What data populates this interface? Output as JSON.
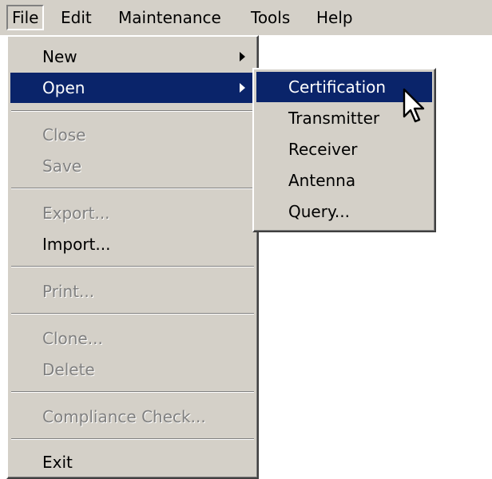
{
  "menubar": {
    "items": [
      {
        "label": "File"
      },
      {
        "label": "Edit"
      },
      {
        "label": "Maintenance"
      },
      {
        "label": "Tools"
      },
      {
        "label": "Help"
      }
    ]
  },
  "file_menu": {
    "items": [
      {
        "label": "New",
        "enabled": true,
        "has_submenu": true
      },
      {
        "label": "Open",
        "enabled": true,
        "has_submenu": true,
        "highlighted": true
      },
      {
        "label": "Close",
        "enabled": false
      },
      {
        "label": "Save",
        "enabled": false
      },
      {
        "label": "Export...",
        "enabled": false
      },
      {
        "label": "Import...",
        "enabled": true
      },
      {
        "label": "Print...",
        "enabled": false
      },
      {
        "label": "Clone...",
        "enabled": false
      },
      {
        "label": "Delete",
        "enabled": false
      },
      {
        "label": "Compliance Check...",
        "enabled": false
      },
      {
        "label": "Exit",
        "enabled": true
      }
    ]
  },
  "open_submenu": {
    "items": [
      {
        "label": "Certification",
        "highlighted": true
      },
      {
        "label": "Transmitter"
      },
      {
        "label": "Receiver"
      },
      {
        "label": "Antenna"
      },
      {
        "label": "Query..."
      }
    ]
  },
  "colors": {
    "menu_background": "#d4d0c8",
    "highlight_background": "#0a246a",
    "highlight_text": "#ffffff",
    "disabled_text": "#808080"
  },
  "icons": {
    "submenu_arrow": "submenu-arrow-icon",
    "mouse_cursor": "mouse-pointer-icon"
  }
}
